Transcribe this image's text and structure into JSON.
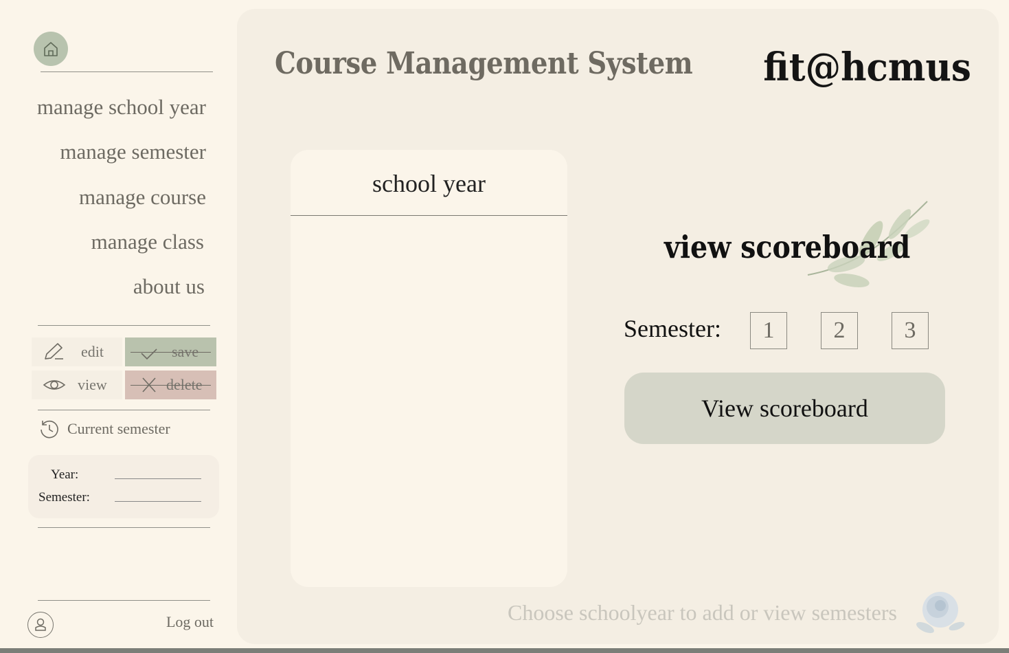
{
  "sidebar": {
    "nav": [
      {
        "label": "manage school year"
      },
      {
        "label": "manage semester"
      },
      {
        "label": "manage course"
      },
      {
        "label": "manage class"
      },
      {
        "label": "about us"
      }
    ],
    "actions": {
      "edit": "edit",
      "save": "save",
      "view": "view",
      "delete": "delete"
    },
    "current_semester": {
      "title": "Current semester",
      "year_label": "Year:",
      "semester_label": "Semester:",
      "year_value": "",
      "semester_value": ""
    },
    "logout": "Log out"
  },
  "header": {
    "title": "Course Management System",
    "brand": "fit@hcmus"
  },
  "school_year_panel": {
    "header": "school year",
    "items": []
  },
  "scoreboard": {
    "title": "view scoreboard",
    "semester_label": "Semester:",
    "semesters": [
      "1",
      "2",
      "3"
    ],
    "button": "View scoreboard"
  },
  "footer": {
    "hint": "Choose schoolyear to add or view semesters"
  },
  "colors": {
    "background": "#fbf5ea",
    "panel": "#f4eee3",
    "save": "#b9c2ad",
    "delete": "#d7bfb6",
    "home": "#b8c3ae",
    "view_button": "#d5d6c9"
  }
}
